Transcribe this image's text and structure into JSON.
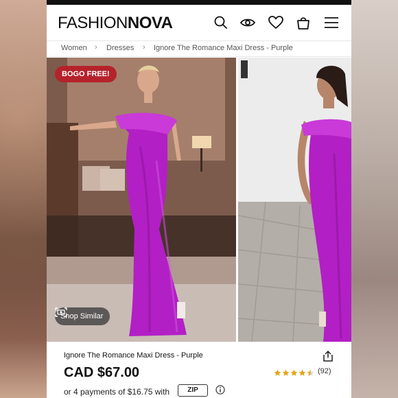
{
  "brand": {
    "logo_light": "FASHION",
    "logo_bold": "NOVA"
  },
  "header": {
    "icons": [
      "search-icon",
      "eye-icon",
      "heart-icon",
      "bag-icon",
      "menu-icon"
    ]
  },
  "breadcrumb": {
    "items": [
      "Women",
      "Dresses",
      "Ignore The Romance Maxi Dress - Purple"
    ]
  },
  "gallery": {
    "badge": "BOGO FREE!",
    "shop_similar": "Shop Similar"
  },
  "product": {
    "title": "Ignore The Romance Maxi Dress - Purple",
    "price": "CAD $67.00",
    "rating": 4.5,
    "review_count": "(92)",
    "installments": "or 4 payments of $16.75 with",
    "pay_provider": "ZIP"
  },
  "colors": {
    "accent_badge": "#b5222b",
    "dress_purple": "#b21fc4",
    "star_gold": "#e3a51b"
  }
}
